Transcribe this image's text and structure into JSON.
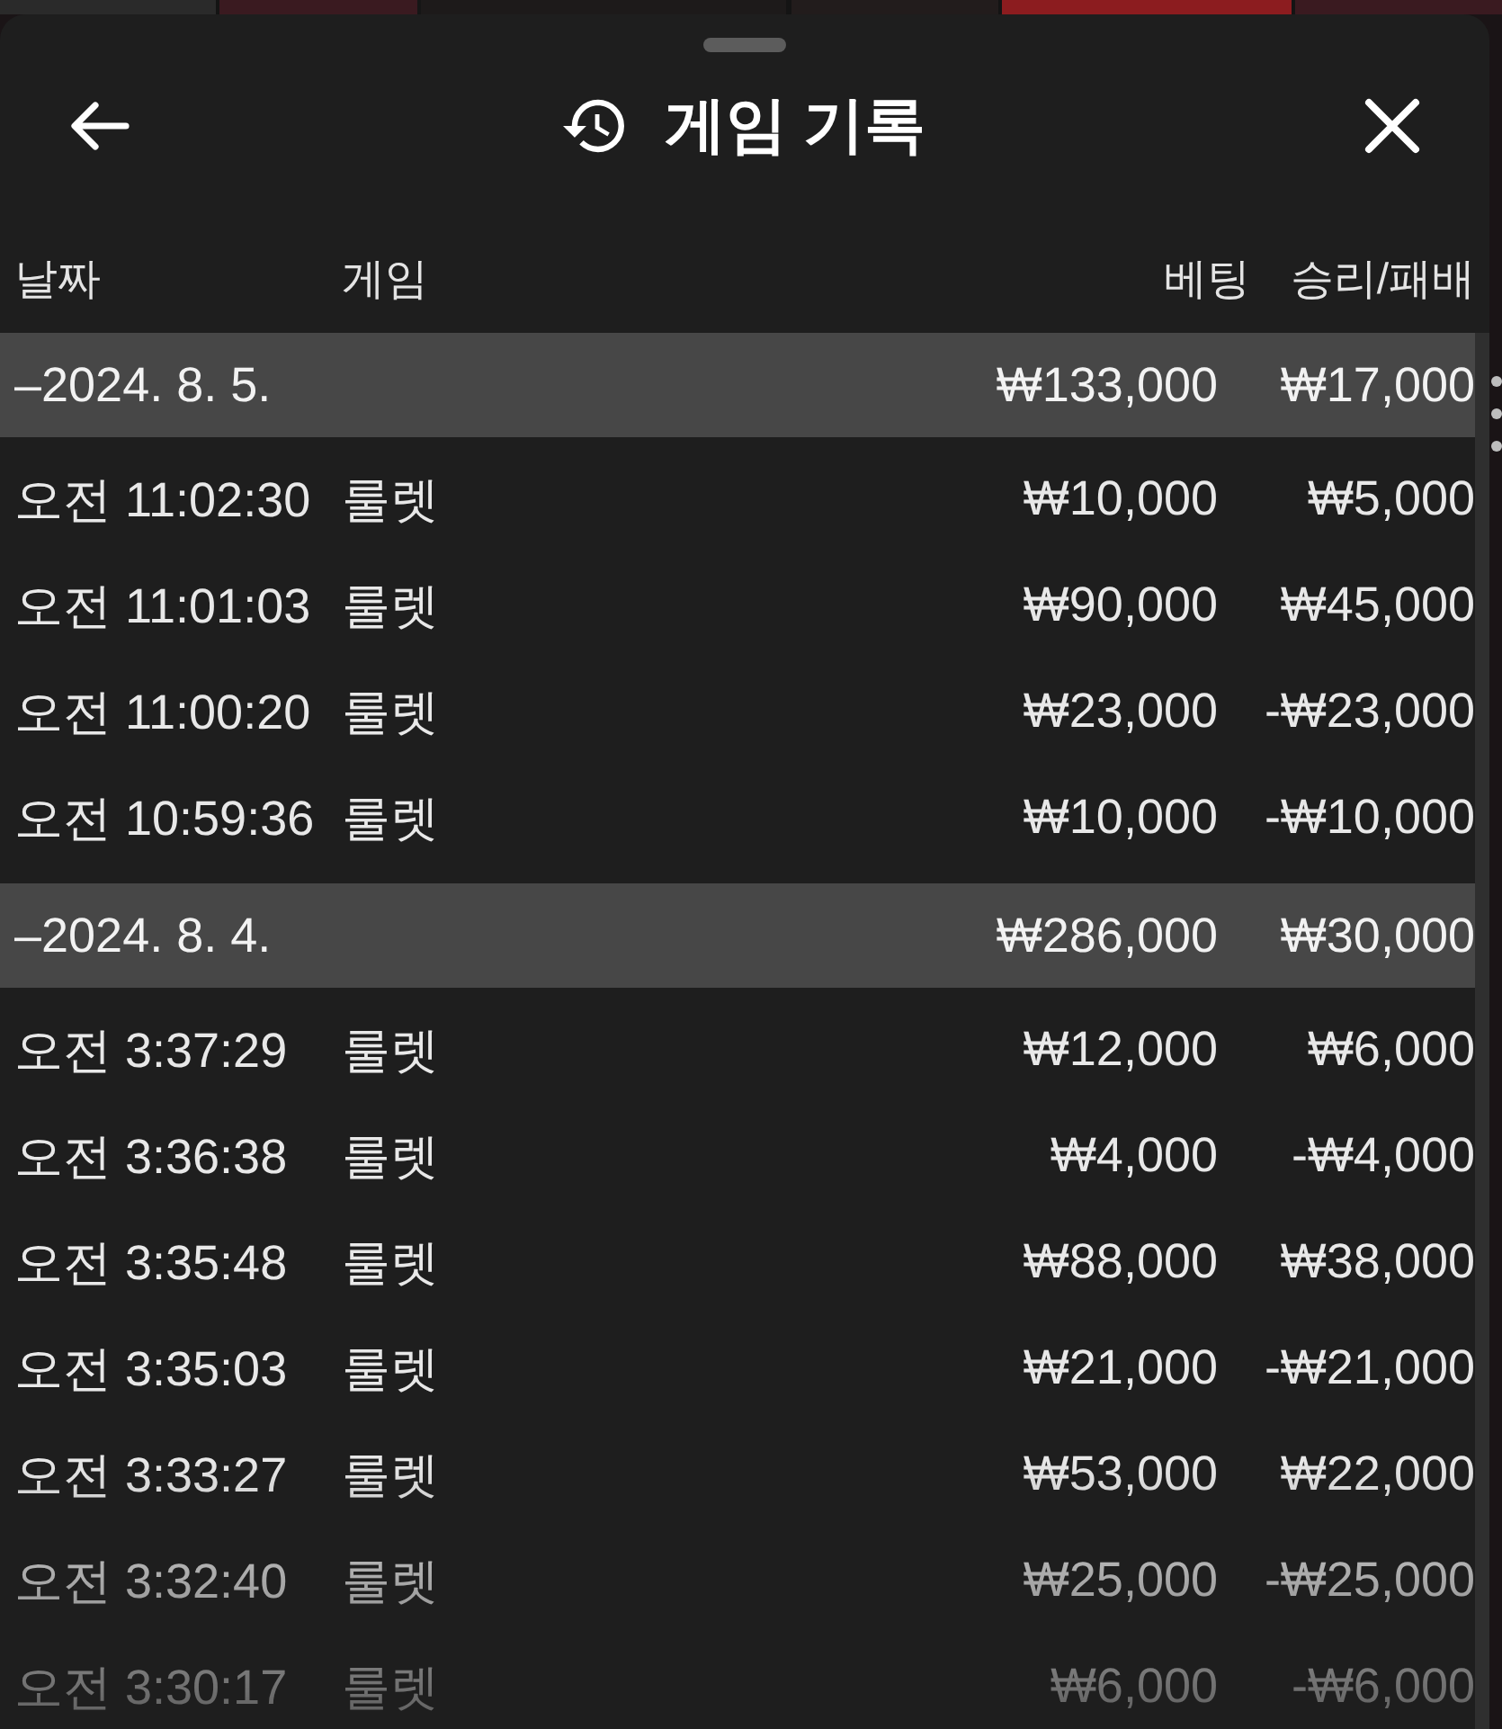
{
  "sheet": {
    "title": "게임 기록"
  },
  "columns": [
    "날짜",
    "게임",
    "베팅",
    "승리/패배"
  ],
  "groups": [
    {
      "date": "–2024. 8. 5.",
      "bet_total": "₩133,000",
      "result_total": "₩17,000",
      "rows": [
        {
          "time": "오전 11:02:30",
          "game": "룰렛",
          "bet": "₩10,000",
          "result": "₩5,000"
        },
        {
          "time": "오전 11:01:03",
          "game": "룰렛",
          "bet": "₩90,000",
          "result": "₩45,000"
        },
        {
          "time": "오전 11:00:20",
          "game": "룰렛",
          "bet": "₩23,000",
          "result": "-₩23,000"
        },
        {
          "time": "오전 10:59:36",
          "game": "룰렛",
          "bet": "₩10,000",
          "result": "-₩10,000"
        }
      ]
    },
    {
      "date": "–2024. 8. 4.",
      "bet_total": "₩286,000",
      "result_total": "₩30,000",
      "rows": [
        {
          "time": "오전 3:37:29",
          "game": "룰렛",
          "bet": "₩12,000",
          "result": "₩6,000"
        },
        {
          "time": "오전 3:36:38",
          "game": "룰렛",
          "bet": "₩4,000",
          "result": "-₩4,000"
        },
        {
          "time": "오전 3:35:48",
          "game": "룰렛",
          "bet": "₩88,000",
          "result": "₩38,000"
        },
        {
          "time": "오전 3:35:03",
          "game": "룰렛",
          "bet": "₩21,000",
          "result": "-₩21,000"
        },
        {
          "time": "오전 3:33:27",
          "game": "룰렛",
          "bet": "₩53,000",
          "result": "₩22,000"
        },
        {
          "time": "오전 3:32:40",
          "game": "룰렛",
          "bet": "₩25,000",
          "result": "-₩25,000"
        },
        {
          "time": "오전 3:30:17",
          "game": "룰렛",
          "bet": "₩6,000",
          "result": "-₩6,000"
        }
      ]
    }
  ]
}
